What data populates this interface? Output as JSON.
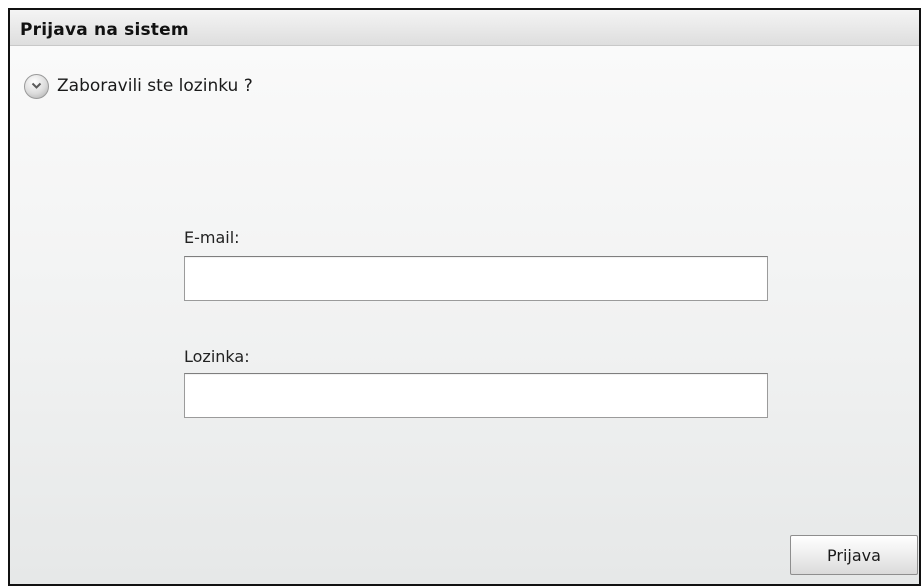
{
  "window": {
    "title": "Prijava na sistem"
  },
  "forgot_password": {
    "label": "Zaboravili ste lozinku ?",
    "icon": "chevron-down-icon"
  },
  "form": {
    "email_label": "E-mail:",
    "email_value": "",
    "password_label": "Lozinka:",
    "password_value": ""
  },
  "actions": {
    "submit_label": "Prijava"
  }
}
